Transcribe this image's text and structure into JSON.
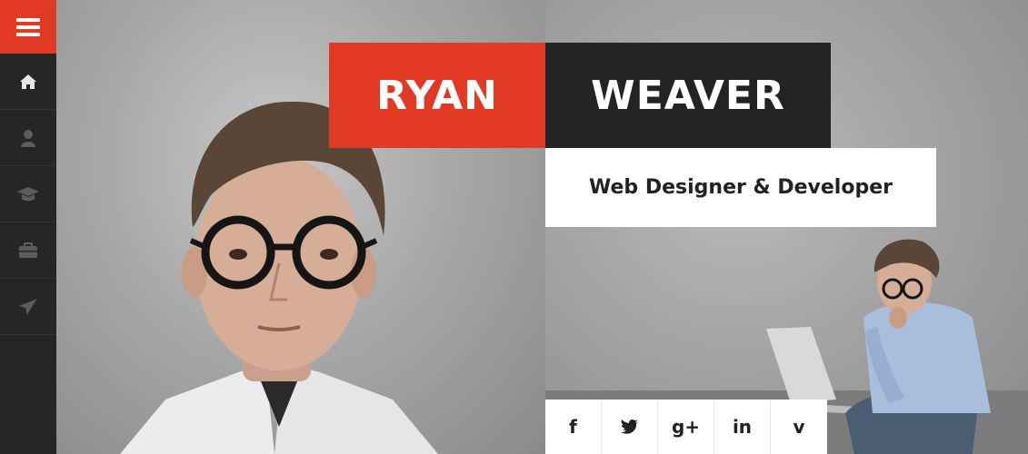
{
  "profile": {
    "first_name": "RYAN",
    "last_name": "WEAVER",
    "subtitle": "Web Designer & Developer"
  },
  "sidebar": {
    "menu_icon": "hamburger-icon",
    "items": [
      {
        "icon": "home-icon"
      },
      {
        "icon": "user-icon"
      },
      {
        "icon": "graduation-cap-icon"
      },
      {
        "icon": "briefcase-icon"
      },
      {
        "icon": "paper-plane-icon"
      }
    ]
  },
  "social": [
    {
      "icon": "facebook-icon",
      "glyph": "f"
    },
    {
      "icon": "twitter-icon",
      "glyph": ""
    },
    {
      "icon": "google-plus-icon",
      "glyph": "g+"
    },
    {
      "icon": "linkedin-icon",
      "glyph": "in"
    },
    {
      "icon": "vimeo-icon",
      "glyph": "v"
    }
  ],
  "colors": {
    "accent": "#e03a25",
    "dark": "#232323",
    "sidebar": "#262626",
    "icon": "#d9d9d9"
  }
}
